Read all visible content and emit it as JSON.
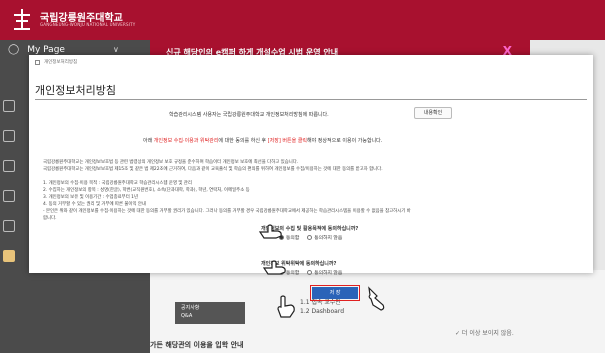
{
  "header": {
    "logo_text": "국립강릉원주대학교",
    "logo_sub": "GANGNEUNG-WONJU NATIONAL UNIVERSITY"
  },
  "sidebar": {
    "mypage_label": "My Page"
  },
  "banner": {
    "text": "신규 해당인의 e캠퍼 하게 개설수업 시범 운영 안내",
    "close": "X"
  },
  "modal": {
    "breadcrumb": "개인정보처리방침",
    "title": "개인정보처리방침",
    "intro": "학습관리시스템 사용자는 국립강릉원주대학교 개인정보처리방침에 따릅니다.",
    "confirm_label": "내용확인",
    "notice_before": "아래 ",
    "notice_red1": "개인정보 수집·이용과 위탁관리",
    "notice_middle": "에 대한 동의를 하신 후 ",
    "notice_red2": "[저장] 버튼을 클릭",
    "notice_after": "해야 정상적으로 이용이 가능합니다.",
    "body_lines": [
      "국립강릉원주대학교는 개인정보보호법 등 관련 법령상의 개인정보 보호 규정을 준수하며 학습이터 개인정보 보호에 최선을 다하고 있습니다.",
      "국립강릉원주대학교는 개인정보보호법 제15조 및 같은 법 제22조에 근거하여, 다음과 같이 교육출석 및 학습의 편의를 위하여 개인정보를 수집/이용하는 것에 대한 동의를 받고자 합니다.",
      "",
      "1. 개인정보의 수집·이용 목적 : 국립강릉원주대학교 학습관리시스템 운영 및 관리",
      "2. 수집하는 개인정보의 항목 : 성명(한글), 학번(교직원번호), 소속(단과대학, 학과), 학년, 연락처, 이메일주소 등",
      "3. 개인정보의 보유 및 이용기간 : 수업종료부터 1년",
      "4. 동의 거부할 수 있는 권리 및 거부에 따른 불이익 안내",
      " - 본인은 위와 같이 개인정보를 수집·이용하는 것에 대한 동의를 거부할 권리가 있습니다. 그러나 동의를 거부할 경우 국립강릉원주대학교에서 제공하는 학습관리시스템을 이용할 수 없음을 참고하시기 바",
      "랍니다."
    ],
    "q1": "개인정보의 수집 및 활용목적에 동의하십니까?",
    "q1_yes": "동의함",
    "q1_no": "동의하지 않음",
    "q2": "개인정보 위탁위탁에 동의하십니까?",
    "q2_yes": "동의함",
    "q2_no": "동의하지 않음",
    "save_label": "저 장"
  },
  "lower": {
    "side_items": [
      "공지사항",
      "Q&A"
    ],
    "list_items": [
      "1.1 접속 교수안",
      "1.2 Dashboard"
    ],
    "dismiss_msg": "✓ 더 이상 보이지 않음.",
    "bottom_text": "가든 해당관의 이용을 입학 안내"
  },
  "colors": {
    "brand": "#a8112f",
    "save": "#2a63b8",
    "highlight": "#e02020"
  }
}
